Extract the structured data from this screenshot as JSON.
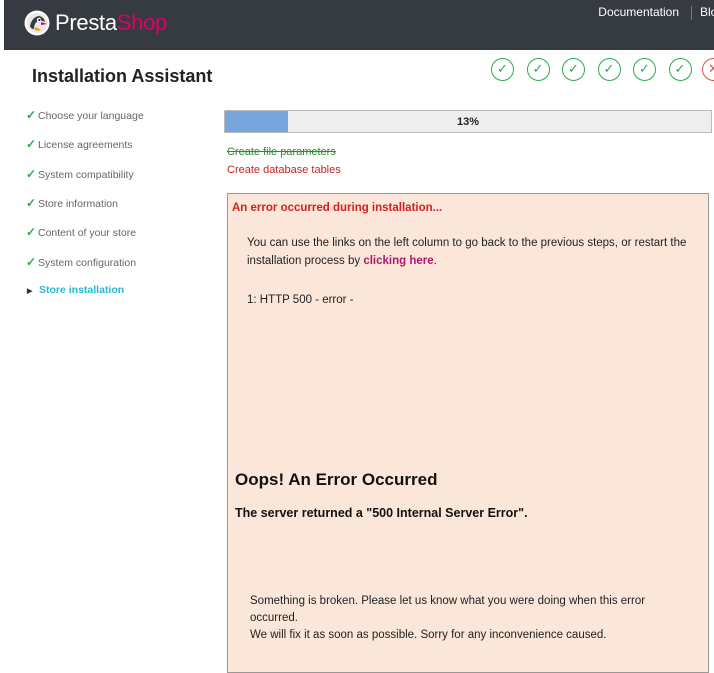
{
  "header": {
    "logo_part1": "Presta",
    "logo_part2": "Shop",
    "nav": {
      "documentation": "Documentation",
      "blog": "Blog"
    }
  },
  "page": {
    "title": "Installation Assistant"
  },
  "steps": [
    {
      "label": "Choose your language",
      "done": true
    },
    {
      "label": "License agreements",
      "done": true
    },
    {
      "label": "System compatibility",
      "done": true
    },
    {
      "label": "Store information",
      "done": true
    },
    {
      "label": "Content of your store",
      "done": true
    },
    {
      "label": "System configuration",
      "done": true
    },
    {
      "label": "Store installation",
      "done": false,
      "current": true
    }
  ],
  "status_icons": {
    "completed": 6,
    "failed": 1
  },
  "progress": {
    "percent": 13,
    "label": "13%"
  },
  "tasks": {
    "completed": "Create file parameters",
    "failed": "Create database tables"
  },
  "error": {
    "heading": "An error occurred during installation...",
    "message_before": "You can use the links on the left column to go back to the previous steps, or restart the installation process by ",
    "link": "clicking here",
    "message_after": ".",
    "detail": "1: HTTP 500 - error -",
    "oops": "Oops! An Error Occurred",
    "server": "The server returned a \"500 Internal Server Error\".",
    "broken_line1": "Something is broken. Please let us know what you were doing when this error occurred.",
    "broken_line2": "We will fix it as soon as possible. Sorry for any inconvenience caused."
  },
  "colors": {
    "header_bg": "#363a41",
    "brand_pink": "#df0067",
    "success_green": "#2fa84f",
    "active_step": "#25b9d7",
    "error_red": "#d62020",
    "error_bg": "#fbe7da",
    "progress_fill": "#77a6dd"
  }
}
